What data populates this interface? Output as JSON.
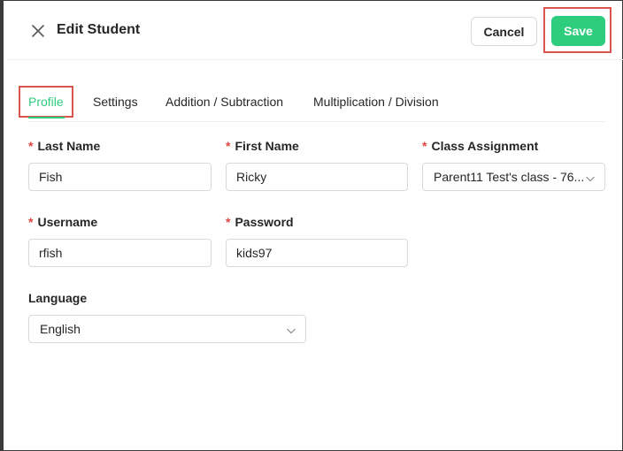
{
  "header": {
    "title": "Edit Student",
    "cancel_label": "Cancel",
    "save_label": "Save"
  },
  "tabs": [
    {
      "label": "Profile",
      "active": true
    },
    {
      "label": "Settings",
      "active": false
    },
    {
      "label": "Addition / Subtraction",
      "active": false
    },
    {
      "label": "Multiplication / Division",
      "active": false
    }
  ],
  "form": {
    "required_mark": "*",
    "last_name": {
      "label": "Last Name",
      "value": "Fish"
    },
    "first_name": {
      "label": "First Name",
      "value": "Ricky"
    },
    "class_assignment": {
      "label": "Class Assignment",
      "value": "Parent11 Test's class - 76..."
    },
    "username": {
      "label": "Username",
      "value": "rfish"
    },
    "password": {
      "label": "Password",
      "value": "kids97"
    },
    "language": {
      "label": "Language",
      "value": "English"
    }
  },
  "colors": {
    "accent": "#2ecc7d",
    "required": "#e0443f",
    "highlight": "#d9534f"
  },
  "icons": {
    "close": "close-icon",
    "dropdown": "chevron-down-icon"
  }
}
